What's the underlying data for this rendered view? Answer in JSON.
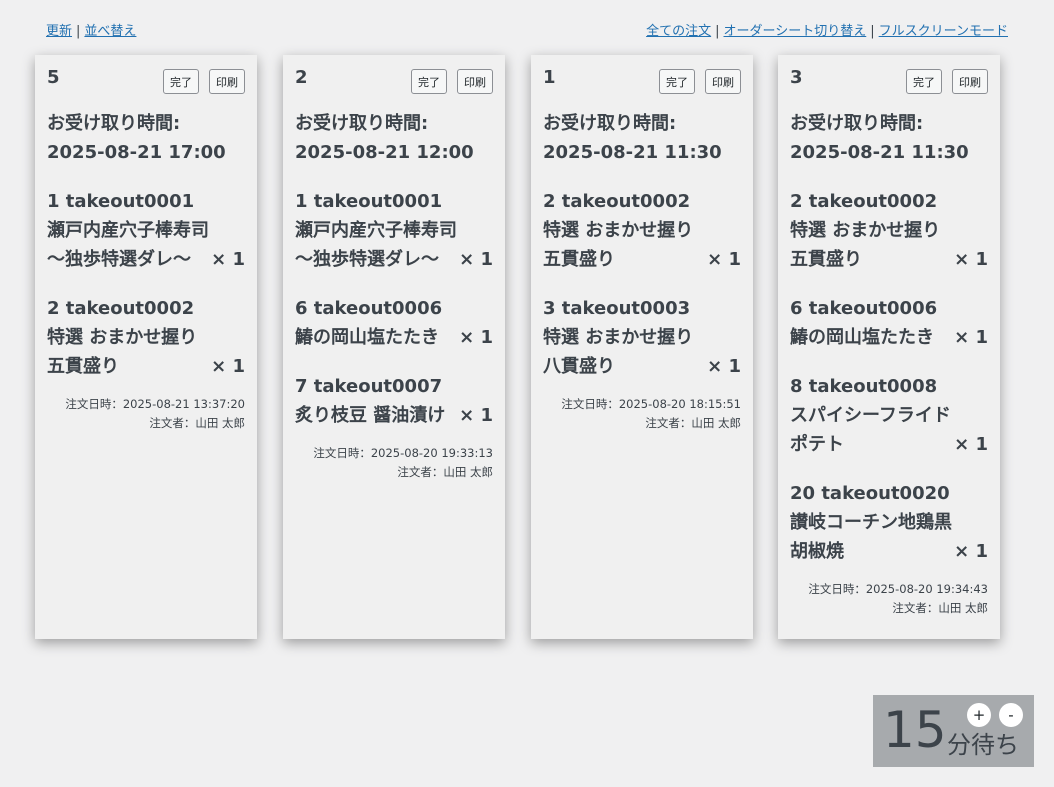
{
  "topbar": {
    "refresh": "更新",
    "sort": "並べ替え",
    "all_orders": "全ての注文",
    "switch_sheet": "オーダーシート切り替え",
    "fullscreen": "フルスクリーンモード",
    "sep": "|"
  },
  "buttons": {
    "done": "完了",
    "print": "印刷"
  },
  "cards": [
    {
      "number": "5",
      "pickup_label": "お受け取り時間:",
      "pickup_time": "2025-08-21 17:00",
      "items": [
        {
          "code": "1 takeout0001",
          "name": "瀬戸内産穴子棒寿司～独歩特選ダレ～",
          "qty": "× 1"
        },
        {
          "code": "2 takeout0002",
          "name": "特選 おまかせ握り五貫盛り",
          "qty": "× 1"
        }
      ],
      "order_date": "注文日時：2025-08-21 13:37:20",
      "orderer": "注文者：山田 太郎"
    },
    {
      "number": "2",
      "pickup_label": "お受け取り時間:",
      "pickup_time": "2025-08-21 12:00",
      "items": [
        {
          "code": "1 takeout0001",
          "name": "瀬戸内産穴子棒寿司～独歩特選ダレ～",
          "qty": "× 1"
        },
        {
          "code": "6 takeout0006",
          "name": "鰆の岡山塩たたき",
          "qty": "× 1"
        },
        {
          "code": "7 takeout0007",
          "name": "炙り枝豆 醤油漬け",
          "qty": "× 1"
        }
      ],
      "order_date": "注文日時：2025-08-20 19:33:13",
      "orderer": "注文者：山田 太郎"
    },
    {
      "number": "1",
      "pickup_label": "お受け取り時間:",
      "pickup_time": "2025-08-21 11:30",
      "items": [
        {
          "code": "2 takeout0002",
          "name": "特選 おまかせ握り五貫盛り",
          "qty": "× 1"
        },
        {
          "code": "3 takeout0003",
          "name": "特選 おまかせ握り八貫盛り",
          "qty": "× 1"
        }
      ],
      "order_date": "注文日時：2025-08-20 18:15:51",
      "orderer": "注文者：山田 太郎"
    },
    {
      "number": "3",
      "pickup_label": "お受け取り時間:",
      "pickup_time": "2025-08-21 11:30",
      "items": [
        {
          "code": "2 takeout0002",
          "name": "特選 おまかせ握り五貫盛り",
          "qty": "× 1"
        },
        {
          "code": "6 takeout0006",
          "name": "鰆の岡山塩たたき",
          "qty": "× 1"
        },
        {
          "code": "8 takeout0008",
          "name": "スパイシーフライドポテト",
          "qty": "× 1"
        },
        {
          "code": "20 takeout0020",
          "name": "讃岐コーチン地鶏黒胡椒焼",
          "qty": "× 1"
        }
      ],
      "order_date": "注文日時：2025-08-20 19:34:43",
      "orderer": "注文者：山田 太郎"
    }
  ],
  "wait": {
    "minutes": "15",
    "unit": "分待ち",
    "plus": "+",
    "minus": "-"
  }
}
